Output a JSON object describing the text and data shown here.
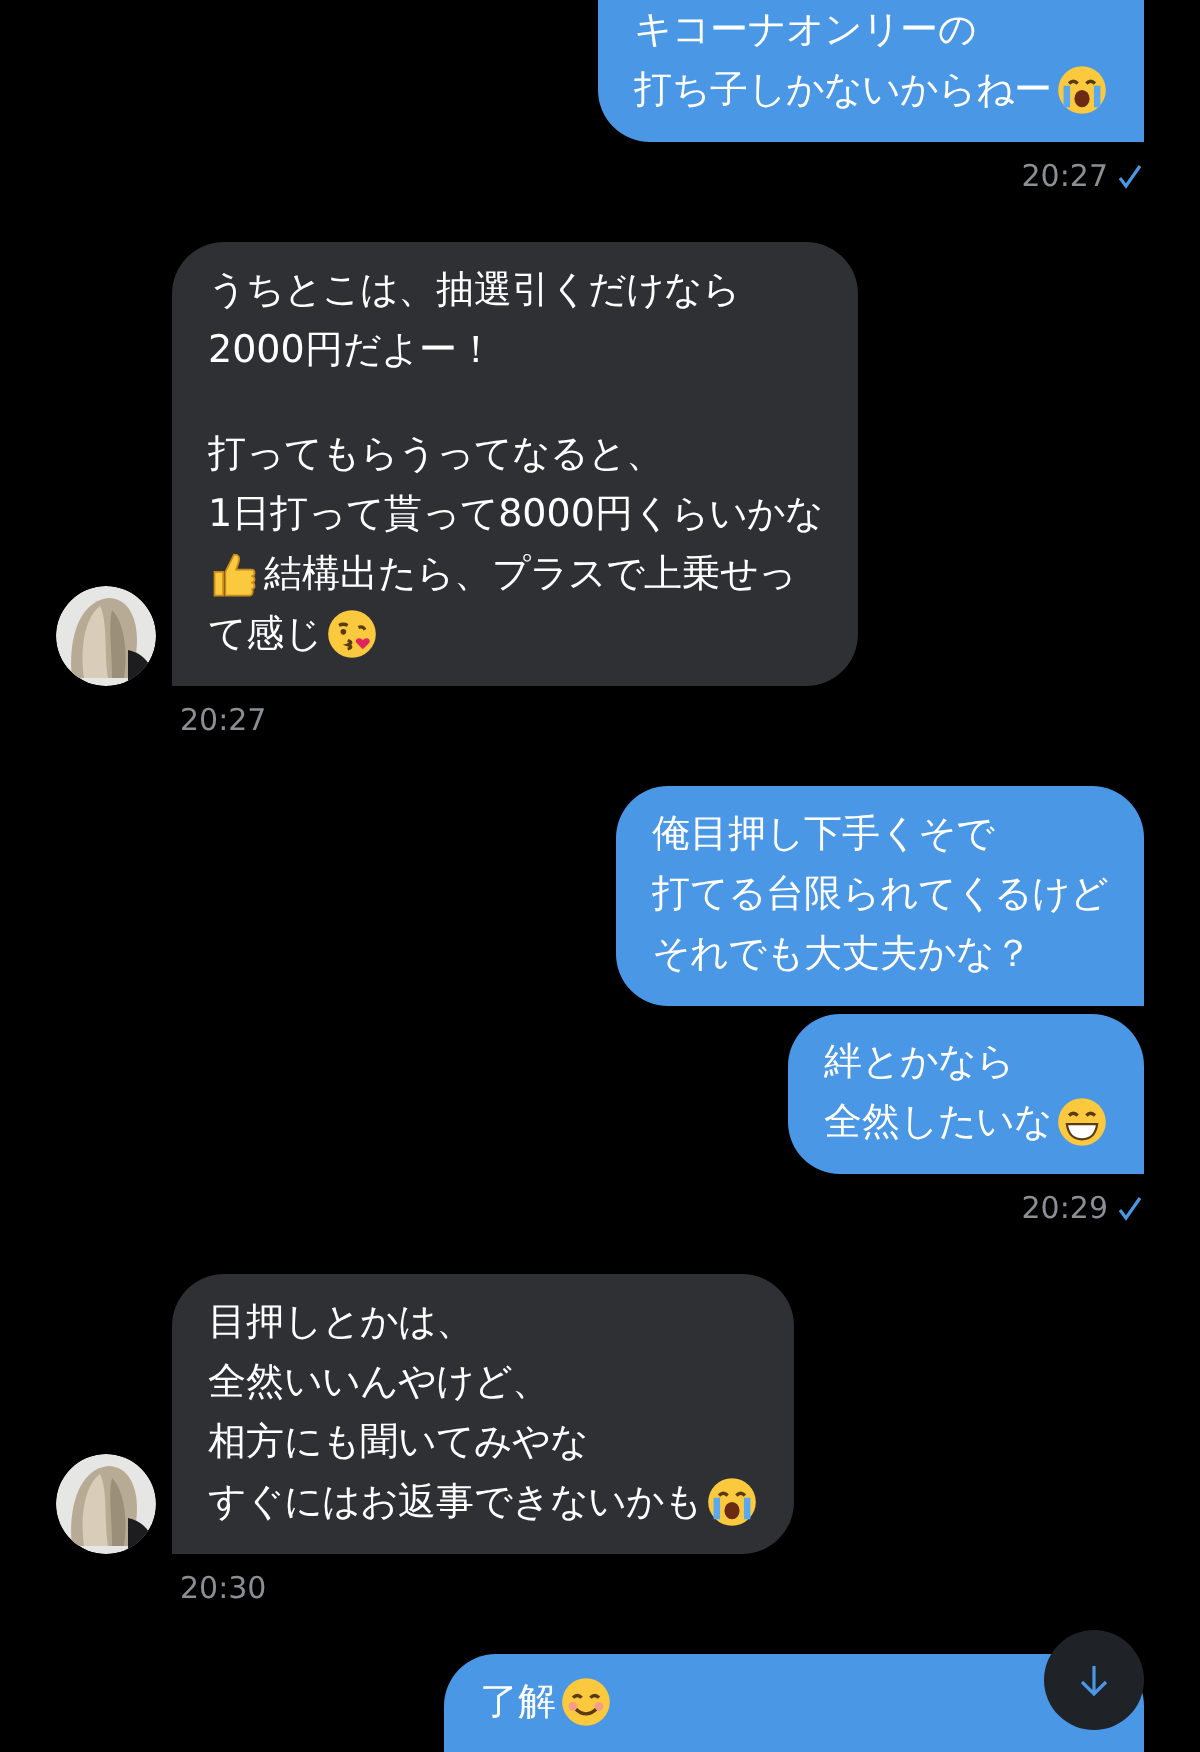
{
  "groups": [
    {
      "kind": "sent",
      "cut_top": true,
      "messages": [
        {
          "paragraphs": [
            [
              [
                {
                  "kind": "text",
                  "text": "キコーナオンリーの"
                }
              ],
              [
                {
                  "kind": "text",
                  "text": "打ち子しかないからねー"
                },
                {
                  "kind": "crying-face"
                }
              ]
            ]
          ]
        }
      ],
      "time": "20:27",
      "read": true
    },
    {
      "kind": "received",
      "messages": [
        {
          "paragraphs": [
            [
              [
                {
                  "kind": "text",
                  "text": "うちとこは、抽選引くだけなら"
                }
              ],
              [
                {
                  "kind": "text",
                  "text": "2000円だよー！"
                }
              ]
            ],
            [
              [
                {
                  "kind": "text",
                  "text": "打ってもらうってなると、"
                }
              ],
              [
                {
                  "kind": "text",
                  "text": "1日打って貰って8000円くらいかな"
                }
              ],
              [
                {
                  "kind": "thumbs-up"
                },
                {
                  "kind": "text",
                  "text": "結構出たら、プラスで上乗せっ"
                }
              ],
              [
                {
                  "kind": "text",
                  "text": "て感じ"
                },
                {
                  "kind": "kissing-face"
                }
              ]
            ]
          ]
        }
      ],
      "time": "20:27"
    },
    {
      "kind": "sent",
      "messages": [
        {
          "paragraphs": [
            [
              [
                {
                  "kind": "text",
                  "text": "俺目押し下手くそで"
                }
              ],
              [
                {
                  "kind": "text",
                  "text": "打てる台限られてくるけど"
                }
              ],
              [
                {
                  "kind": "text",
                  "text": "それでも大丈夫かな？"
                }
              ]
            ]
          ]
        },
        {
          "paragraphs": [
            [
              [
                {
                  "kind": "text",
                  "text": "絆とかなら"
                }
              ],
              [
                {
                  "kind": "text",
                  "text": "全然したいな"
                },
                {
                  "kind": "grinning-face"
                }
              ]
            ]
          ]
        }
      ],
      "time": "20:29",
      "read": true
    },
    {
      "kind": "received",
      "messages": [
        {
          "paragraphs": [
            [
              [
                {
                  "kind": "text",
                  "text": "目押しとかは、"
                }
              ],
              [
                {
                  "kind": "text",
                  "text": "全然いいんやけど、"
                }
              ],
              [
                {
                  "kind": "text",
                  "text": "相方にも聞いてみやな"
                }
              ],
              [
                {
                  "kind": "text",
                  "text": "すぐにはお返事できないかも"
                },
                {
                  "kind": "crying-face"
                }
              ]
            ]
          ]
        }
      ],
      "time": "20:30"
    },
    {
      "kind": "sent",
      "cut_bottom": true,
      "messages": [
        {
          "paragraphs": [
            [
              [
                {
                  "kind": "text",
                  "text": "了解"
                },
                {
                  "kind": "smiling-face"
                }
              ]
            ]
          ]
        }
      ]
    }
  ],
  "scroll_button": {
    "kind": "down"
  }
}
